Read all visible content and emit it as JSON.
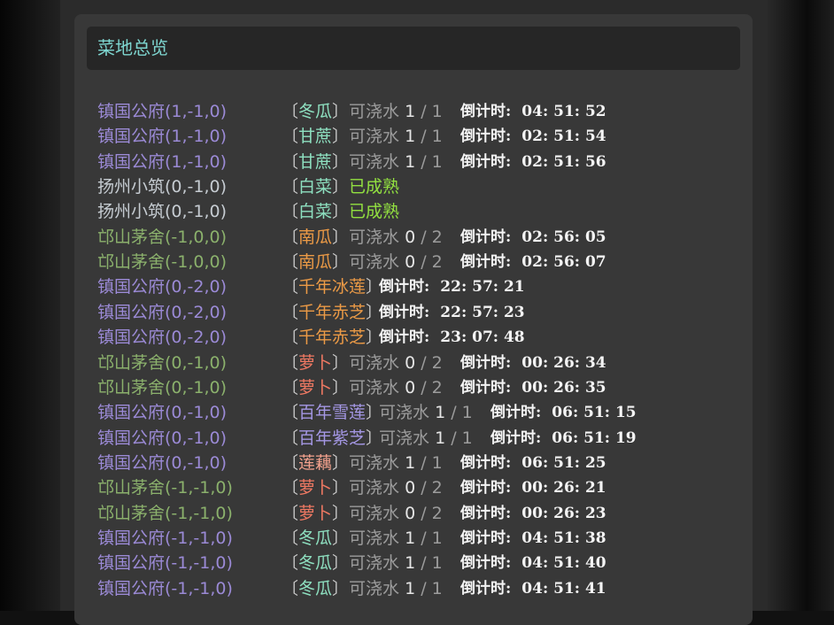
{
  "header": {
    "title": "菜地总览"
  },
  "labels": {
    "water": "可浇水",
    "countdown": "倒计时:",
    "ripe": "已成熟",
    "lb": "〔",
    "rb": "〕",
    "sep": "/"
  },
  "colors": {
    "location_purple": "#9b8ad6",
    "location_green": "#8bb16c",
    "location_light": "#c6ccd2",
    "ripe": "#92e040"
  },
  "rows": [
    {
      "loc": "镇国公府(1,-1,0)",
      "loc_color": "purple",
      "crop": "冬瓜",
      "crop_color": "teal",
      "water_cur": "1",
      "water_max": "1",
      "time": "04: 51: 52"
    },
    {
      "loc": "镇国公府(1,-1,0)",
      "loc_color": "purple",
      "crop": "甘蔗",
      "crop_color": "teal",
      "water_cur": "1",
      "water_max": "1",
      "time": "02: 51: 54"
    },
    {
      "loc": "镇国公府(1,-1,0)",
      "loc_color": "purple",
      "crop": "甘蔗",
      "crop_color": "teal",
      "water_cur": "1",
      "water_max": "1",
      "time": "02: 51: 56"
    },
    {
      "loc": "扬州小筑(0,-1,0)",
      "loc_color": "light",
      "crop": "白菜",
      "crop_color": "teal",
      "ripe": true
    },
    {
      "loc": "扬州小筑(0,-1,0)",
      "loc_color": "light",
      "crop": "白菜",
      "crop_color": "teal",
      "ripe": true
    },
    {
      "loc": "邙山茅舍(-1,0,0)",
      "loc_color": "green",
      "crop": "南瓜",
      "crop_color": "orange",
      "water_cur": "0",
      "water_max": "2",
      "time": "02: 56: 05"
    },
    {
      "loc": "邙山茅舍(-1,0,0)",
      "loc_color": "green",
      "crop": "南瓜",
      "crop_color": "orange",
      "water_cur": "0",
      "water_max": "2",
      "time": "02: 56: 07"
    },
    {
      "loc": "镇国公府(0,-2,0)",
      "loc_color": "purple",
      "crop": "千年冰莲",
      "crop_color": "orange",
      "time": "22: 57: 21"
    },
    {
      "loc": "镇国公府(0,-2,0)",
      "loc_color": "purple",
      "crop": "千年赤芝",
      "crop_color": "orange",
      "time": "22: 57: 23"
    },
    {
      "loc": "镇国公府(0,-2,0)",
      "loc_color": "purple",
      "crop": "千年赤芝",
      "crop_color": "orange",
      "time": "23: 07: 48"
    },
    {
      "loc": "邙山茅舍(0,-1,0)",
      "loc_color": "green",
      "crop": "萝卜",
      "crop_color": "salmon",
      "water_cur": "0",
      "water_max": "2",
      "time": "00: 26: 34"
    },
    {
      "loc": "邙山茅舍(0,-1,0)",
      "loc_color": "green",
      "crop": "萝卜",
      "crop_color": "salmon",
      "water_cur": "0",
      "water_max": "2",
      "time": "00: 26: 35"
    },
    {
      "loc": "镇国公府(0,-1,0)",
      "loc_color": "purple",
      "crop": "百年雪莲",
      "crop_color": "lilac",
      "water_cur": "1",
      "water_max": "1",
      "time": "06: 51: 15"
    },
    {
      "loc": "镇国公府(0,-1,0)",
      "loc_color": "purple",
      "crop": "百年紫芝",
      "crop_color": "lilac",
      "water_cur": "1",
      "water_max": "1",
      "time": "06: 51: 19"
    },
    {
      "loc": "镇国公府(0,-1,0)",
      "loc_color": "purple",
      "crop": "莲藕",
      "crop_color": "rose",
      "water_cur": "1",
      "water_max": "1",
      "time": "06: 51: 25"
    },
    {
      "loc": "邙山茅舍(-1,-1,0)",
      "loc_color": "green",
      "crop": "萝卜",
      "crop_color": "salmon",
      "water_cur": "0",
      "water_max": "2",
      "time": "00: 26: 21"
    },
    {
      "loc": "邙山茅舍(-1,-1,0)",
      "loc_color": "green",
      "crop": "萝卜",
      "crop_color": "salmon",
      "water_cur": "0",
      "water_max": "2",
      "time": "00: 26: 23"
    },
    {
      "loc": "镇国公府(-1,-1,0)",
      "loc_color": "purple",
      "crop": "冬瓜",
      "crop_color": "teal",
      "water_cur": "1",
      "water_max": "1",
      "time": "04: 51: 38"
    },
    {
      "loc": "镇国公府(-1,-1,0)",
      "loc_color": "purple",
      "crop": "冬瓜",
      "crop_color": "teal",
      "water_cur": "1",
      "water_max": "1",
      "time": "04: 51: 40"
    },
    {
      "loc": "镇国公府(-1,-1,0)",
      "loc_color": "purple",
      "crop": "冬瓜",
      "crop_color": "teal",
      "water_cur": "1",
      "water_max": "1",
      "time": "04: 51: 41"
    }
  ]
}
